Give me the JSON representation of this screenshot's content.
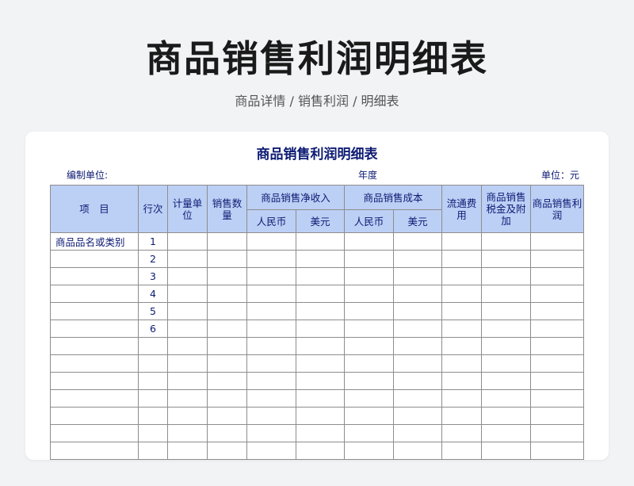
{
  "page": {
    "title": "商品销售利润明细表",
    "subtitle": "商品详情 / 销售利润 / 明细表"
  },
  "sheet": {
    "title": "商品销售利润明细表",
    "compiler_label": "编制单位:",
    "year_label": "年度",
    "unit_label": "单位：元"
  },
  "table": {
    "headers": {
      "item": "项　目",
      "row_no": "行次",
      "unit": "计量单位",
      "qty": "销售数量",
      "net_income": "商品销售净收入",
      "cost": "商品销售成本",
      "rmb": "人民币",
      "usd": "美元",
      "circ_fee": "流通费用",
      "tax": "商品销售税金及附加",
      "profit": "商品销售利润"
    },
    "rows": [
      {
        "item": "商品品名或类别",
        "row_no": "1"
      },
      {
        "item": "",
        "row_no": "2"
      },
      {
        "item": "",
        "row_no": "3"
      },
      {
        "item": "",
        "row_no": "4"
      },
      {
        "item": "",
        "row_no": "5"
      },
      {
        "item": "",
        "row_no": "6"
      },
      {
        "item": "",
        "row_no": ""
      },
      {
        "item": "",
        "row_no": ""
      },
      {
        "item": "",
        "row_no": ""
      },
      {
        "item": "",
        "row_no": ""
      },
      {
        "item": "",
        "row_no": ""
      },
      {
        "item": "",
        "row_no": ""
      },
      {
        "item": "",
        "row_no": ""
      },
      {
        "item": "",
        "row_no": ""
      }
    ]
  }
}
